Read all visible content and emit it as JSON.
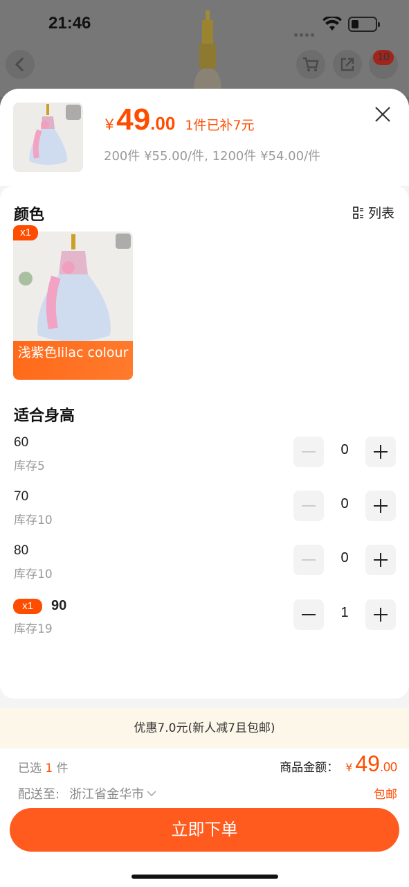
{
  "status_bar": {
    "time": "21:46"
  },
  "background": {
    "cart_badge": "10"
  },
  "header": {
    "currency": "¥",
    "price_int": "49",
    "price_dec": ".00",
    "subsidy": "1件已补7元",
    "tier_pricing": "200件 ¥55.00/件, 1200件 ¥54.00/件"
  },
  "color_section": {
    "title": "颜色",
    "list_toggle": "列表",
    "selected_badge": "x1",
    "item_label": "浅紫色lilac colour"
  },
  "size_section": {
    "title": "适合身高",
    "rows": [
      {
        "size": "60",
        "stock": "库存5",
        "qty": "0",
        "badge": ""
      },
      {
        "size": "70",
        "stock": "库存10",
        "qty": "0",
        "badge": ""
      },
      {
        "size": "80",
        "stock": "库存10",
        "qty": "0",
        "badge": ""
      },
      {
        "size": "90",
        "stock": "库存19",
        "qty": "1",
        "badge": "x1"
      }
    ]
  },
  "promo": {
    "text": "优惠7.0元(新人减7且包邮)"
  },
  "footer": {
    "selected_prefix": "已选",
    "selected_count": "1",
    "selected_suffix": "件",
    "amount_label": "商品金额：",
    "currency": "¥",
    "amount_int": "49",
    "amount_dec": ".00",
    "ship_label": "配送至:",
    "ship_location": "浙江省金华市",
    "free_shipping": "包邮",
    "order_button": "立即下单"
  },
  "colors": {
    "accent": "#ff4d00",
    "button": "#ff5b1f",
    "promo_bg": "#fdf7e9"
  }
}
